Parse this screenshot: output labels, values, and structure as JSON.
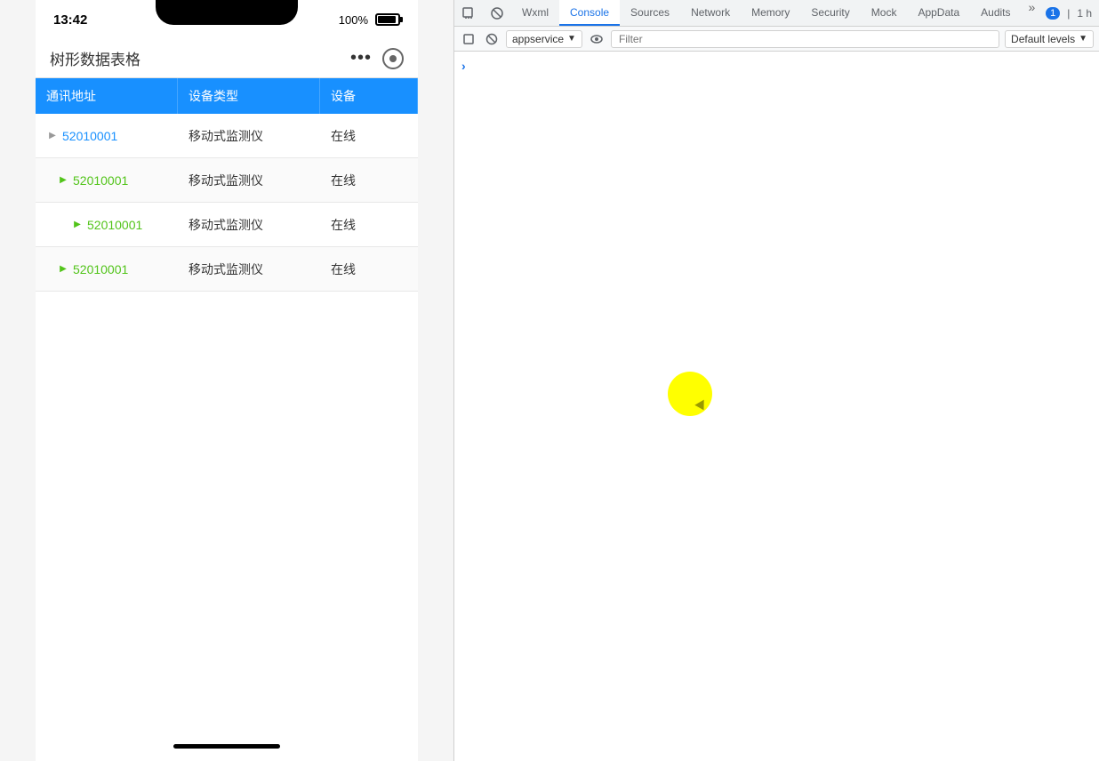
{
  "devtools": {
    "tabs": [
      {
        "id": "wxml",
        "label": "Wxml",
        "active": false
      },
      {
        "id": "console",
        "label": "Console",
        "active": true
      },
      {
        "id": "sources",
        "label": "Sources",
        "active": false
      },
      {
        "id": "network",
        "label": "Network",
        "active": false
      },
      {
        "id": "memory",
        "label": "Memory",
        "active": false
      },
      {
        "id": "security",
        "label": "Security",
        "active": false
      },
      {
        "id": "mock",
        "label": "Mock",
        "active": false
      },
      {
        "id": "appdata",
        "label": "AppData",
        "active": false
      },
      {
        "id": "audits",
        "label": "Audits",
        "active": false
      }
    ],
    "toolbar": {
      "context_selector": "appservice",
      "filter_placeholder": "Filter",
      "levels_label": "Default levels"
    },
    "badge": "1",
    "time_label": "1 h"
  },
  "mobile": {
    "status_bar": {
      "time": "13:42",
      "battery_percent": "100%"
    },
    "title": "树形数据表格",
    "table": {
      "headers": [
        "通讯地址",
        "设备类型",
        "设备"
      ],
      "rows": [
        {
          "id": "52010001",
          "type": "移动式监测仪",
          "status": "在线",
          "level": 0,
          "expandable": true,
          "color": "default"
        },
        {
          "id": "52010001",
          "type": "移动式监测仪",
          "status": "在线",
          "level": 1,
          "expandable": true,
          "color": "green"
        },
        {
          "id": "52010001",
          "type": "移动式监测仪",
          "status": "在线",
          "level": 2,
          "expandable": true,
          "color": "green"
        },
        {
          "id": "52010001",
          "type": "移动式监测仪",
          "status": "在线",
          "level": 1,
          "expandable": true,
          "color": "green"
        }
      ]
    }
  }
}
